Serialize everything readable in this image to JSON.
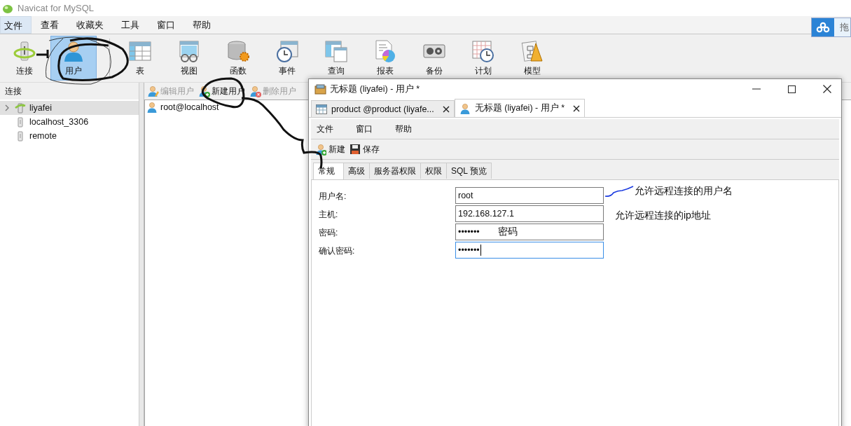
{
  "app_title": "Navicat for MySQL",
  "menu": [
    {
      "label": "文件",
      "selected": true
    },
    {
      "label": "查看",
      "selected": false
    },
    {
      "label": "收藏夹",
      "selected": false
    },
    {
      "label": "工具",
      "selected": false
    },
    {
      "label": "窗口",
      "selected": false
    },
    {
      "label": "帮助",
      "selected": false
    }
  ],
  "cloud_button": {
    "label": "拖"
  },
  "toolbar": [
    {
      "label": "连接",
      "selected": false
    },
    {
      "label": "用户",
      "selected": true
    },
    {
      "label": "表",
      "selected": false
    },
    {
      "label": "视图",
      "selected": false
    },
    {
      "label": "函数",
      "selected": false
    },
    {
      "label": "事件",
      "selected": false
    },
    {
      "label": "查询",
      "selected": false
    },
    {
      "label": "报表",
      "selected": false
    },
    {
      "label": "备份",
      "selected": false
    },
    {
      "label": "计划",
      "selected": false
    },
    {
      "label": "模型",
      "selected": false
    }
  ],
  "connections": {
    "header": "连接",
    "items": [
      {
        "label": "liyafei",
        "kind": "connected",
        "selected": true
      },
      {
        "label": "localhost_3306",
        "kind": "closed",
        "selected": false
      },
      {
        "label": "remote",
        "kind": "closed",
        "selected": false
      }
    ]
  },
  "users_panel": {
    "actions": [
      {
        "label": "编辑用户",
        "disabled": true
      },
      {
        "label": "新建用户",
        "disabled": false
      },
      {
        "label": "删除用户",
        "disabled": true
      }
    ],
    "items": [
      "root@localhost"
    ]
  },
  "dialog": {
    "title": "无标题 (liyafei) - 用户 *",
    "doc_tabs": [
      {
        "label": "product @product (liyafe...",
        "selected": false
      },
      {
        "label": "无标题 (liyafei) - 用户 *",
        "selected": true
      }
    ],
    "menu": [
      "文件",
      "窗口",
      "帮助"
    ],
    "actions": [
      "新建",
      "保存"
    ],
    "tabs": [
      {
        "label": "常规",
        "selected": true
      },
      {
        "label": "高级",
        "selected": false
      },
      {
        "label": "服务器权限",
        "selected": false
      },
      {
        "label": "权限",
        "selected": false
      },
      {
        "label": "SQL 预览",
        "selected": false
      }
    ],
    "fields": [
      {
        "label": "用户名:",
        "value": "root",
        "focused": false,
        "note": "允许远程连接的用户名"
      },
      {
        "label": "主机:",
        "value": "192.168.127.1",
        "focused": false,
        "note": "允许远程连接的ip地址"
      },
      {
        "label": "密码:",
        "value": "•••••••",
        "focused": false,
        "note": "密码"
      },
      {
        "label": "确认密码:",
        "value": "•••••••",
        "focused": true
      }
    ]
  }
}
